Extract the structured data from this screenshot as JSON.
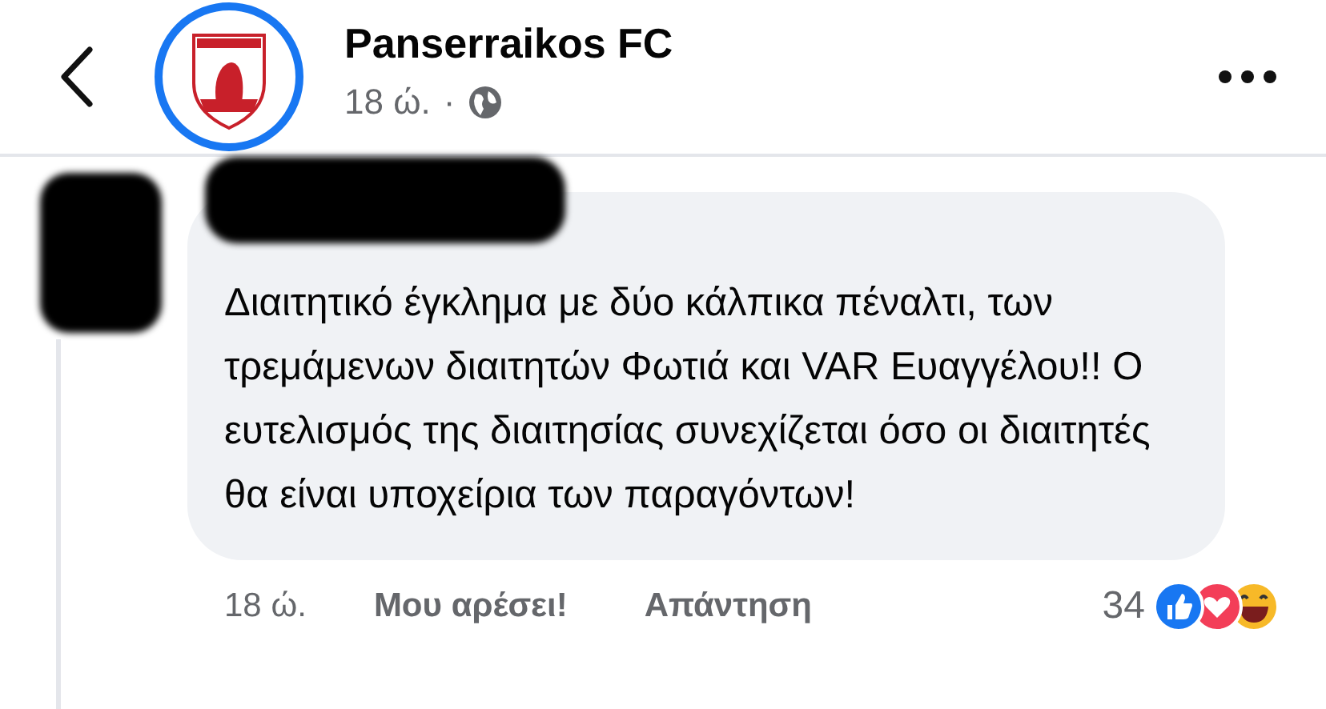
{
  "header": {
    "title": "Panserraikos FC",
    "time": "18 ώ.",
    "separator": "·"
  },
  "comment": {
    "text": "Διαιτητικό έγκλημα με δύο κάλπικα πέναλτι, των τρεμάμενων διαιτητών Φωτιά και VAR Ευαγγέλου!! Ο ευτελισμός της διαιτησίας συνεχίζεται όσο οι διαιτητές θα είναι υποχείρια των παραγόντων!",
    "time": "18 ώ.",
    "like": "Μου αρέσει!",
    "reply": "Απάντηση",
    "reaction_count": "34"
  }
}
